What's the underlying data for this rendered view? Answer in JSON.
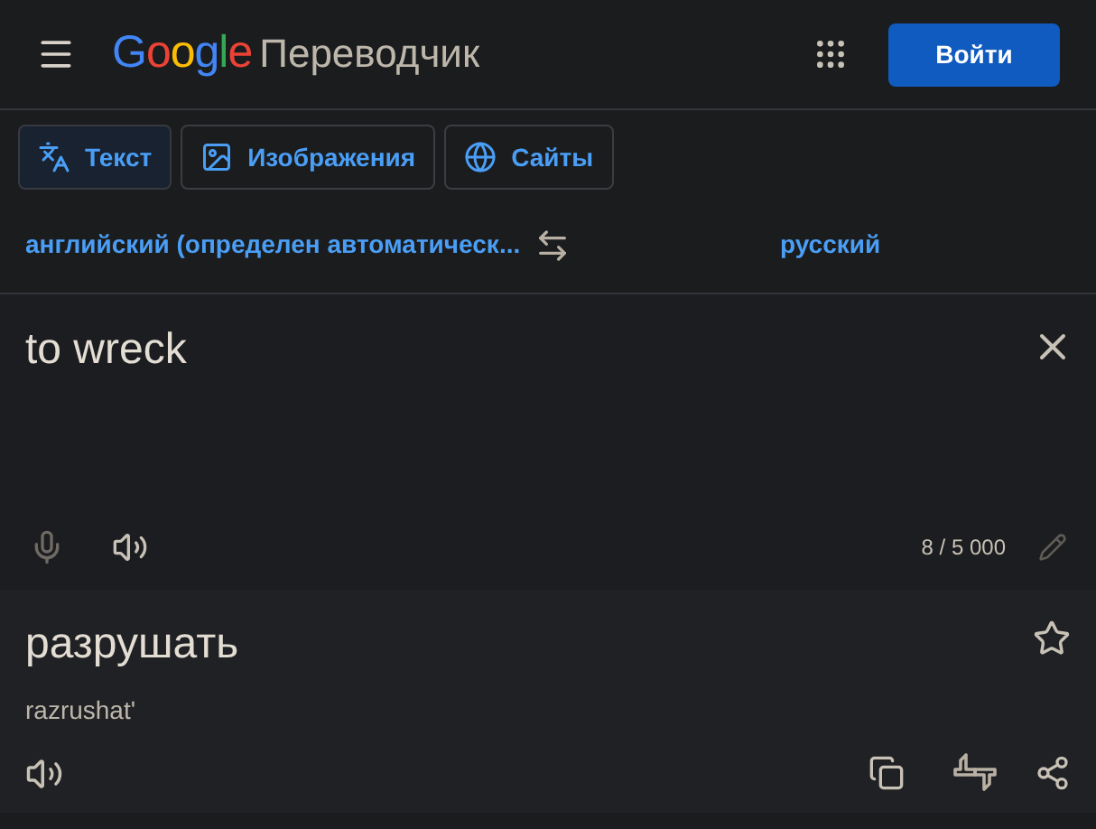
{
  "header": {
    "logo": "Google",
    "product": "Переводчик",
    "sign_in": "Войти"
  },
  "tabs": [
    {
      "label": "Текст",
      "kind": "text",
      "selected": true
    },
    {
      "label": "Изображения",
      "kind": "image",
      "selected": false
    },
    {
      "label": "Сайты",
      "kind": "site",
      "selected": false
    }
  ],
  "languages": {
    "source": "английский (определен автоматическ...",
    "target": "русский"
  },
  "input": {
    "value": "to wreck",
    "counter": "8 / 5 000"
  },
  "output": {
    "text": "разрушать",
    "transliteration": "razrushat'"
  }
}
